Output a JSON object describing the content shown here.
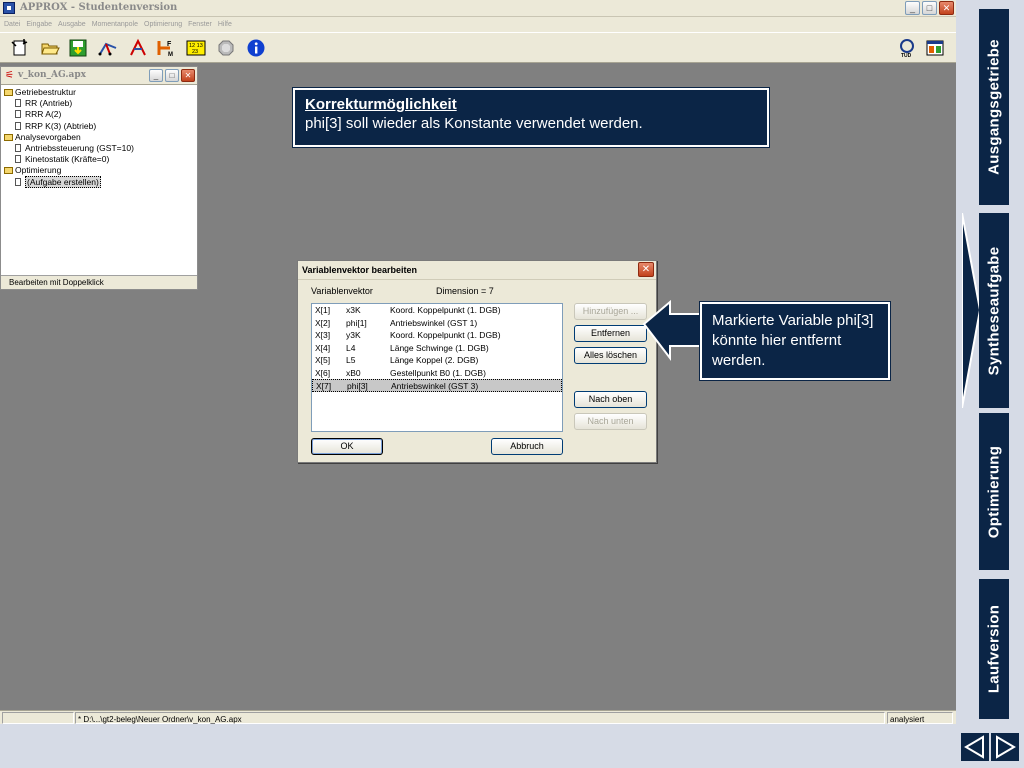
{
  "window": {
    "title": "APPROX - Studentenversion",
    "menu": [
      "Datei",
      "Eingabe",
      "Ausgabe",
      "Momentanpole",
      "Optimierung",
      "Fenster",
      "Hilfe"
    ]
  },
  "project_window": {
    "title": "v_kon_AG.apx",
    "tree": [
      {
        "label": "Getriebestruktur",
        "level": 0,
        "type": "folder"
      },
      {
        "label": "RR (Antrieb)",
        "level": 1,
        "type": "doc"
      },
      {
        "label": "RRR A(2)",
        "level": 1,
        "type": "doc"
      },
      {
        "label": "RRP K(3) (Abtrieb)",
        "level": 1,
        "type": "doc"
      },
      {
        "label": "Analysevorgaben",
        "level": 0,
        "type": "folder"
      },
      {
        "label": "Antriebssteuerung (GST=10)",
        "level": 1,
        "type": "doc"
      },
      {
        "label": "Kinetostatik (Kräfte=0)",
        "level": 1,
        "type": "doc"
      },
      {
        "label": "Optimierung",
        "level": 0,
        "type": "folder"
      },
      {
        "label": "(Aufgabe erstellen)",
        "level": 1,
        "type": "doc"
      }
    ],
    "status": "Bearbeiten mit Doppelklick"
  },
  "note": {
    "heading": "Korrekturmöglichkeit",
    "body": "phi[3] soll wieder als Konstante verwendet werden."
  },
  "dialog": {
    "title": "Variablenvektor bearbeiten",
    "list_label": "Variablenvektor",
    "dimension": "Dimension =  7",
    "rows": [
      [
        "X[1]",
        "x3K",
        "Koord. Koppelpunkt (1. DGB)"
      ],
      [
        "X[2]",
        "phi[1]",
        "Antriebswinkel (GST 1)"
      ],
      [
        "X[3]",
        "y3K",
        "Koord. Koppelpunkt (1. DGB)"
      ],
      [
        "X[4]",
        "L4",
        "Länge Schwinge (1. DGB)"
      ],
      [
        "X[5]",
        "L5",
        "Länge Koppel (2. DGB)"
      ],
      [
        "X[6]",
        "xB0",
        "Gestellpunkt B0 (1. DGB)"
      ],
      [
        "X[7]",
        "phi[3]",
        "Antriebswinkel (GST 3)"
      ]
    ],
    "selected_row": 6,
    "buttons": {
      "add": "Hinzufügen ...",
      "remove": "Entfernen",
      "clear": "Alles löschen",
      "up": "Nach oben",
      "down": "Nach unten",
      "ok": "OK",
      "cancel": "Abbruch"
    }
  },
  "callout": {
    "text": "Markierte Variable phi[3] könnte hier entfernt werden."
  },
  "statusbar": {
    "path": "* D:\\...\\gt2-beleg\\Neuer Ordner\\v_kon_AG.apx",
    "state": "analysiert"
  },
  "side_tabs": [
    "Ausgangsgetriebe",
    "Syntheseaufgabe",
    "Optimierung",
    "Laufversion"
  ],
  "colors": {
    "navy": "#0b2546",
    "desktop": "#808080"
  }
}
